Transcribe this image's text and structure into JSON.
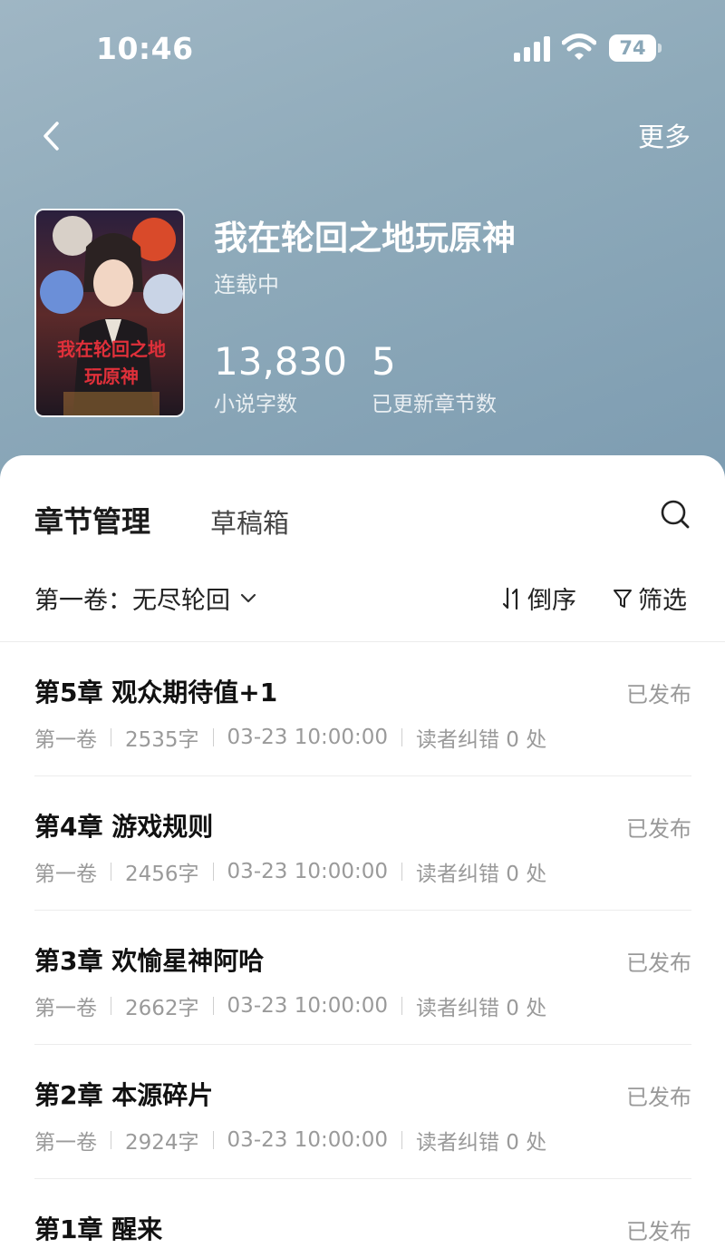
{
  "status_bar": {
    "time": "10:46",
    "battery": "74"
  },
  "nav": {
    "more_label": "更多"
  },
  "book": {
    "title": "我在轮回之地玩原神",
    "status": "连载中",
    "cover_text_line1": "我在轮回之地",
    "cover_text_line2": "玩原神",
    "word_count": "13,830",
    "word_count_label": "小说字数",
    "updated_chapters": "5",
    "updated_chapters_label": "已更新章节数"
  },
  "tabs": {
    "active": "章节管理",
    "drafts": "草稿箱"
  },
  "toolbar": {
    "volume": "第一卷：无尽轮回",
    "sort_label": "倒序",
    "filter_label": "筛选"
  },
  "chapters": [
    {
      "title": "第5章  观众期待值+1",
      "state": "已发布",
      "volume": "第一卷",
      "words": "2535字",
      "date": "03-23 10:00:00",
      "errata": "读者纠错 0 处"
    },
    {
      "title": "第4章  游戏规则",
      "state": "已发布",
      "volume": "第一卷",
      "words": "2456字",
      "date": "03-23 10:00:00",
      "errata": "读者纠错 0 处"
    },
    {
      "title": "第3章  欢愉星神阿哈",
      "state": "已发布",
      "volume": "第一卷",
      "words": "2662字",
      "date": "03-23 10:00:00",
      "errata": "读者纠错 0 处"
    },
    {
      "title": "第2章  本源碎片",
      "state": "已发布",
      "volume": "第一卷",
      "words": "2924字",
      "date": "03-23 10:00:00",
      "errata": "读者纠错 0 处"
    },
    {
      "title": "第1章  醒来",
      "state": "已发布"
    }
  ]
}
